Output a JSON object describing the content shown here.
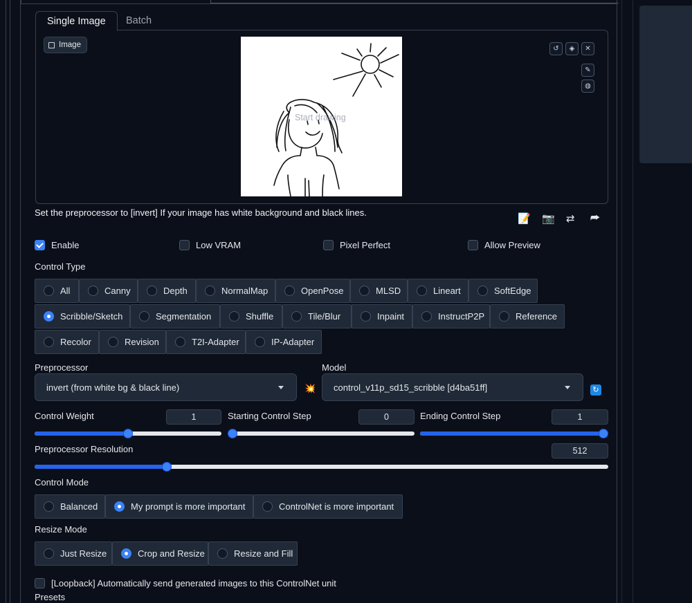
{
  "tabs": [
    {
      "label": "Single Image",
      "active": true
    },
    {
      "label": "Batch",
      "active": false
    }
  ],
  "image_panel": {
    "label": "Image",
    "canvas_hint": "Start drawing"
  },
  "hint": "Set the preprocessor to [invert] If your image has white background and black lines.",
  "toolbar_icons": [
    "edit-icon",
    "camera-icon",
    "swap-icon",
    "send-icon"
  ],
  "checkboxes": {
    "enable": {
      "label": "Enable",
      "checked": true
    },
    "low_vram": {
      "label": "Low VRAM",
      "checked": false
    },
    "pixel_perfect": {
      "label": "Pixel Perfect",
      "checked": false
    },
    "allow_preview": {
      "label": "Allow Preview",
      "checked": false
    }
  },
  "control_type": {
    "label": "Control Type",
    "options": [
      "All",
      "Canny",
      "Depth",
      "NormalMap",
      "OpenPose",
      "MLSD",
      "Lineart",
      "SoftEdge",
      "Scribble/Sketch",
      "Segmentation",
      "Shuffle",
      "Tile/Blur",
      "Inpaint",
      "InstructP2P",
      "Reference",
      "Recolor",
      "Revision",
      "T2I-Adapter",
      "IP-Adapter"
    ],
    "selected": "Scribble/Sketch"
  },
  "preprocessor": {
    "label": "Preprocessor",
    "value": "invert (from white bg & black line)"
  },
  "model": {
    "label": "Model",
    "value": "control_v11p_sd15_scribble [d4ba51ff]"
  },
  "control_weight": {
    "label": "Control Weight",
    "value": "1",
    "fraction": 0.5
  },
  "starting_step": {
    "label": "Starting Control Step",
    "value": "0",
    "fraction": 0.0
  },
  "ending_step": {
    "label": "Ending Control Step",
    "value": "1",
    "fraction": 1.0
  },
  "preprocessor_resolution": {
    "label": "Preprocessor Resolution",
    "value": "512",
    "fraction": 0.23
  },
  "control_mode": {
    "label": "Control Mode",
    "options": [
      "Balanced",
      "My prompt is more important",
      "ControlNet is more important"
    ],
    "selected": "My prompt is more important"
  },
  "resize_mode": {
    "label": "Resize Mode",
    "options": [
      "Just Resize",
      "Crop and Resize",
      "Resize and Fill"
    ],
    "selected": "Crop and Resize"
  },
  "loopback": {
    "label": "[Loopback] Automatically send generated images to this ControlNet unit",
    "checked": false
  },
  "presets_label": "Presets",
  "colors": {
    "accent": "#3b82f6",
    "background": "#0b0f19",
    "panel": "#1f2937",
    "border": "#374151"
  }
}
